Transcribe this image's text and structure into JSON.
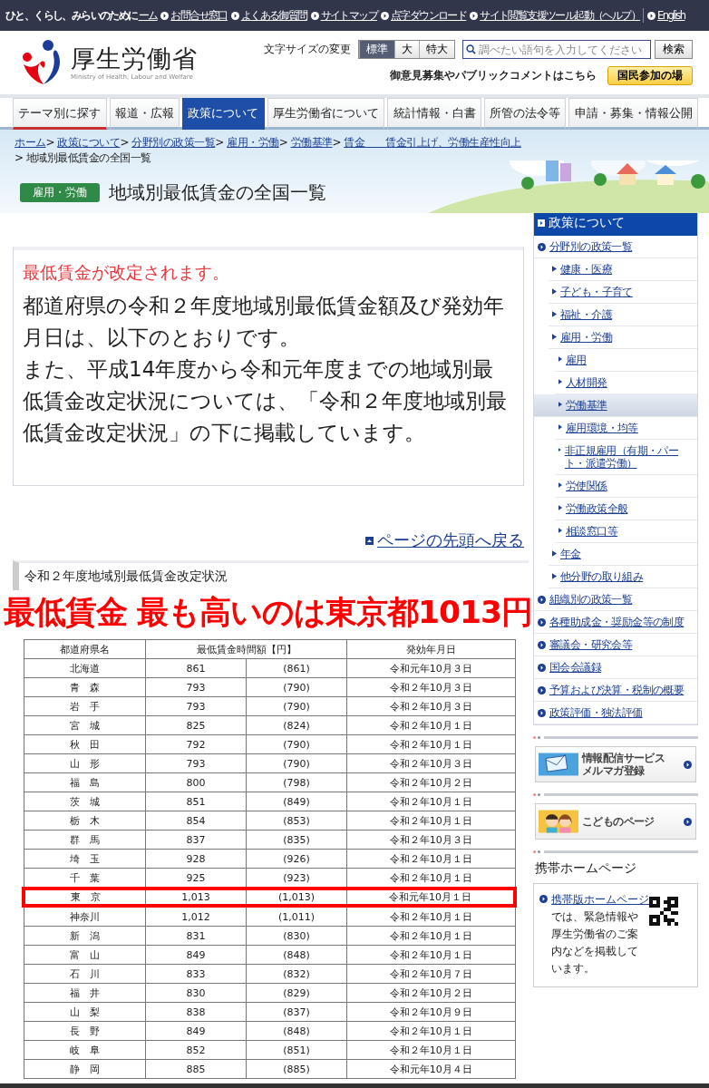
{
  "top_bar": {
    "tagline": "ひと、くらし、みらいのために",
    "home_link": "ーム",
    "links": [
      "お問合せ窓口",
      "よくある御質問",
      "サイトマップ",
      "点字ダウンロード",
      "サイト閲覧支援ツール起動（ヘルプ）",
      "English"
    ]
  },
  "header": {
    "logo_title": "厚生労働省",
    "logo_subtitle": "Ministry of Health, Labour and Welfare",
    "font_size": {
      "label": "文字サイズの変更",
      "options": [
        {
          "label": "標準",
          "selected": true
        },
        {
          "label": "大",
          "selected": false
        },
        {
          "label": "特大",
          "selected": false
        }
      ]
    },
    "search": {
      "placeholder": "調べたい語句を入力してください",
      "button": "検索"
    },
    "comment_text": "御意見募集やパブリックコメントはこちら",
    "participation_button": "国民参加の場"
  },
  "nav_tabs": [
    {
      "label": "テーマ別に探す",
      "selected": false
    },
    {
      "label": "報道・広報",
      "selected": false
    },
    {
      "label": "政策について",
      "selected": true
    },
    {
      "label": "厚生労働省について",
      "selected": false
    },
    {
      "label": "統計情報・白書",
      "selected": false
    },
    {
      "label": "所管の法令等",
      "selected": false
    },
    {
      "label": "申請・募集・情報公開",
      "selected": false
    }
  ],
  "breadcrumb": {
    "separator": ">",
    "links": [
      "ホーム",
      "政策について",
      "分野別の政策一覧",
      "雇用・労働",
      "労働基準",
      "賃金　　賃金引上げ、労働生産性向上"
    ],
    "current": "地域別最低賃金の全国一覧"
  },
  "page": {
    "category": "雇用・労働",
    "title": "地域別最低賃金の全国一覧"
  },
  "notice": {
    "heading": "最低賃金が改定されます。",
    "paragraphs": [
      "都道府県の令和２年度地域別最低賃金額及び発効年月日は、以下のとおりです。",
      "また、平成14年度から令和元年度までの地域別最低賃金改定状況については、「令和２年度地域別最低賃金改定状況」の下に掲載しています。"
    ]
  },
  "back_to_top": "ページの先頭へ戻る",
  "section_heading": "令和２年度地域別最低賃金改定状況",
  "headline": "最低賃金 最も高いのは東京都1013円",
  "table": {
    "columns": [
      "都道府県名",
      "最低賃金時間額【円】",
      "発効年月日"
    ],
    "rows": [
      {
        "name": "北海道",
        "wage": "861",
        "previous": "(861)",
        "date": "令和元年10月３日",
        "highlighted": false
      },
      {
        "name": "青　森",
        "wage": "793",
        "previous": "(790)",
        "date": "令和２年10月３日",
        "highlighted": false
      },
      {
        "name": "岩　手",
        "wage": "793",
        "previous": "(790)",
        "date": "令和２年10月３日",
        "highlighted": false
      },
      {
        "name": "宮　城",
        "wage": "825",
        "previous": "(824)",
        "date": "令和２年10月１日",
        "highlighted": false
      },
      {
        "name": "秋　田",
        "wage": "792",
        "previous": "(790)",
        "date": "令和２年10月１日",
        "highlighted": false
      },
      {
        "name": "山　形",
        "wage": "793",
        "previous": "(790)",
        "date": "令和２年10月３日",
        "highlighted": false
      },
      {
        "name": "福　島",
        "wage": "800",
        "previous": "(798)",
        "date": "令和２年10月２日",
        "highlighted": false
      },
      {
        "name": "茨　城",
        "wage": "851",
        "previous": "(849)",
        "date": "令和２年10月１日",
        "highlighted": false
      },
      {
        "name": "栃　木",
        "wage": "854",
        "previous": "(853)",
        "date": "令和２年10月１日",
        "highlighted": false
      },
      {
        "name": "群　馬",
        "wage": "837",
        "previous": "(835)",
        "date": "令和２年10月３日",
        "highlighted": false
      },
      {
        "name": "埼　玉",
        "wage": "928",
        "previous": "(926)",
        "date": "令和２年10月１日",
        "highlighted": false
      },
      {
        "name": "千　葉",
        "wage": "925",
        "previous": "(923)",
        "date": "令和２年10月１日",
        "highlighted": false
      },
      {
        "name": "東　京",
        "wage": "1,013",
        "previous": "(1,013)",
        "date": "令和元年10月１日",
        "highlighted": true
      },
      {
        "name": "神奈川",
        "wage": "1,012",
        "previous": "(1,011)",
        "date": "令和２年10月１日",
        "highlighted": false
      },
      {
        "name": "新　潟",
        "wage": "831",
        "previous": "(830)",
        "date": "令和２年10月１日",
        "highlighted": false
      },
      {
        "name": "富　山",
        "wage": "849",
        "previous": "(848)",
        "date": "令和２年10月１日",
        "highlighted": false
      },
      {
        "name": "石　川",
        "wage": "833",
        "previous": "(832)",
        "date": "令和２年10月７日",
        "highlighted": false
      },
      {
        "name": "福　井",
        "wage": "830",
        "previous": "(829)",
        "date": "令和２年10月２日",
        "highlighted": false
      },
      {
        "name": "山　梨",
        "wage": "838",
        "previous": "(837)",
        "date": "令和２年10月９日",
        "highlighted": false
      },
      {
        "name": "長　野",
        "wage": "849",
        "previous": "(848)",
        "date": "令和２年10月１日",
        "highlighted": false
      },
      {
        "name": "岐　阜",
        "wage": "852",
        "previous": "(851)",
        "date": "令和２年10月１日",
        "highlighted": false
      },
      {
        "name": "静　岡",
        "wage": "885",
        "previous": "(885)",
        "date": "令和元年10月４日",
        "highlighted": false
      }
    ]
  },
  "sidebar": {
    "title": "政策について",
    "items": [
      {
        "label": "分野別の政策一覧",
        "selected": false,
        "children": [
          {
            "label": "健康・医療",
            "selected": false
          },
          {
            "label": "子ども・子育て",
            "selected": false
          },
          {
            "label": "福祉・介護",
            "selected": false
          },
          {
            "label": "雇用・労働",
            "selected": false,
            "children": [
              {
                "label": "雇用",
                "selected": false
              },
              {
                "label": "人材開発",
                "selected": false
              },
              {
                "label": "労働基準",
                "selected": true
              },
              {
                "label": "雇用環境・均等",
                "selected": false
              },
              {
                "label": "非正規雇用（有期・パート・派遣労働）",
                "selected": false
              },
              {
                "label": "労使関係",
                "selected": false
              },
              {
                "label": "労働政策全般",
                "selected": false
              },
              {
                "label": "相談窓口等",
                "selected": false
              }
            ]
          },
          {
            "label": "年金",
            "selected": false
          },
          {
            "label": "他分野の取り組み",
            "selected": false
          }
        ]
      },
      {
        "label": "組織別の政策一覧",
        "selected": false
      },
      {
        "label": "各種助成金・奨励金等の制度",
        "selected": false
      },
      {
        "label": "審議会・研究会等",
        "selected": false
      },
      {
        "label": "国会会議録",
        "selected": false
      },
      {
        "label": "予算および決算・税制の概要",
        "selected": false
      },
      {
        "label": "政策評価・独法評価",
        "selected": false
      }
    ]
  },
  "promos": [
    {
      "kind": "mail",
      "lines": [
        "情報配信サービス",
        "メルマガ登録"
      ]
    },
    {
      "kind": "kids",
      "lines": [
        "こどものページ"
      ]
    }
  ],
  "mobile": {
    "heading": "携帯ホームページ",
    "link": "携帯版ホームページ",
    "text": "では、緊急情報や厚生労働省のご案内などを掲載しています。"
  }
}
